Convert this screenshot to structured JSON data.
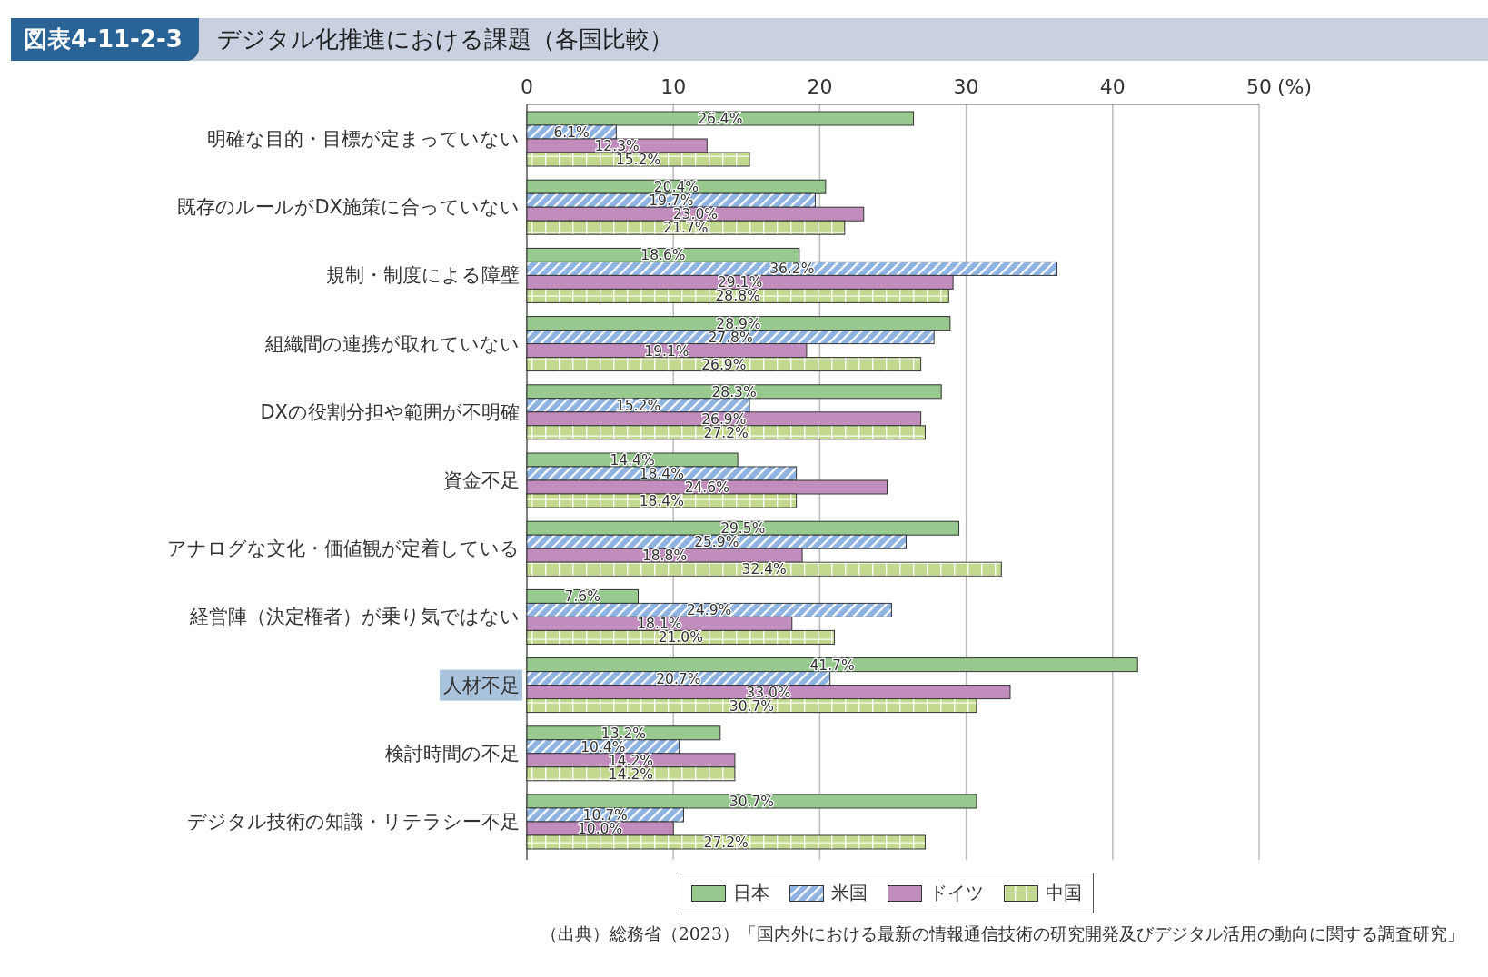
{
  "header": {
    "figure_number": "図表4-11-2-3",
    "title": "デジタル化推進における課題（各国比較）"
  },
  "chart_data": {
    "type": "bar",
    "orientation": "horizontal",
    "grid": true,
    "xlabel": "(%)",
    "xlim": [
      0,
      50
    ],
    "xticks": [
      0,
      10,
      20,
      30,
      40,
      50
    ],
    "categories": [
      "明確な目的・目標が定まっていない",
      "既存のルールがDX施策に合っていない",
      "規制・制度による障壁",
      "組織間の連携が取れていない",
      "DXの役割分担や範囲が不明確",
      "資金不足",
      "アナログな文化・価値観が定着している",
      "経営陣（決定権者）が乗り気ではない",
      "人材不足",
      "検討時間の不足",
      "デジタル技術の知識・リテラシー不足"
    ],
    "series": [
      {
        "name": "日本",
        "color": "#98c98f",
        "values": [
          26.4,
          20.4,
          18.6,
          28.9,
          28.3,
          14.4,
          29.5,
          7.6,
          41.7,
          13.2,
          30.7
        ],
        "value_labels": [
          "26.4%",
          "20.4%",
          "18.6%",
          "28.9%",
          "28.3%",
          "14.4%",
          "29.5%",
          "7.6%",
          "41.7%",
          "13.2%",
          "30.7%"
        ]
      },
      {
        "name": "米国",
        "color": "#8fb3e0",
        "values": [
          6.1,
          19.7,
          36.2,
          27.8,
          15.2,
          18.4,
          25.9,
          24.9,
          20.7,
          10.4,
          10.7
        ],
        "value_labels": [
          "6.1%",
          "19.7%",
          "36.2%",
          "27.8%",
          "15.2%",
          "18.4%",
          "25.9%",
          "24.9%",
          "20.7%",
          "10.4%",
          "10.7%"
        ]
      },
      {
        "name": "ドイツ",
        "color": "#c08dbd",
        "values": [
          12.3,
          23.0,
          29.1,
          19.1,
          26.9,
          24.6,
          18.8,
          18.1,
          33.0,
          14.2,
          10.0
        ],
        "value_labels": [
          "12.3%",
          "23.0%",
          "29.1%",
          "19.1%",
          "26.9%",
          "24.6%",
          "18.8%",
          "18.1%",
          "33.0%",
          "14.2%",
          "10.0%"
        ]
      },
      {
        "name": "中国",
        "color": "#c2d98f",
        "values": [
          15.2,
          21.7,
          28.8,
          26.9,
          27.2,
          18.4,
          32.4,
          21.0,
          30.7,
          14.2,
          27.2
        ],
        "value_labels": [
          "15.2%",
          "21.7%",
          "28.8%",
          "26.9%",
          "27.2%",
          "18.4%",
          "32.4%",
          "21.0%",
          "30.7%",
          "14.2%",
          "27.2%"
        ]
      }
    ]
  },
  "category_states": [
    {
      "highlighted": false
    },
    {
      "highlighted": false
    },
    {
      "highlighted": false
    },
    {
      "highlighted": false
    },
    {
      "highlighted": false
    },
    {
      "highlighted": false
    },
    {
      "highlighted": false
    },
    {
      "highlighted": false
    },
    {
      "highlighted": true
    },
    {
      "highlighted": false
    },
    {
      "highlighted": false
    }
  ],
  "source": "（出典）総務省（2023）「国内外における最新の情報通信技術の研究開発及びデジタル活用の動向に関する調査研究」"
}
